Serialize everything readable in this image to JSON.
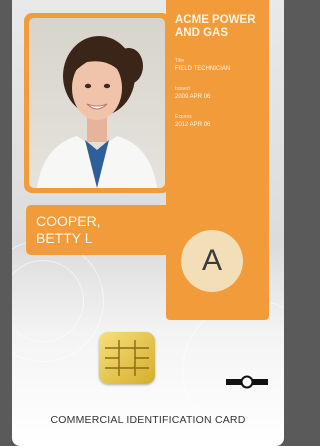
{
  "card": {
    "company": "ACME POWER AND GAS",
    "title_label": "Title",
    "title_value": "FIELD TECHNICIAN",
    "issued_label": "Issued",
    "issued_value": "2009 APR 06",
    "expires_label": "Expires",
    "expires_value": "2012 APR 06",
    "last_name": "COOPER,",
    "first_name": "BETTY L",
    "class_letter": "A",
    "footer": "COMMERCIAL IDENTIFICATION CARD",
    "colors": {
      "accent": "#f29b3a",
      "badge": "#f2dfb7",
      "background": "#5a5a5a"
    }
  }
}
